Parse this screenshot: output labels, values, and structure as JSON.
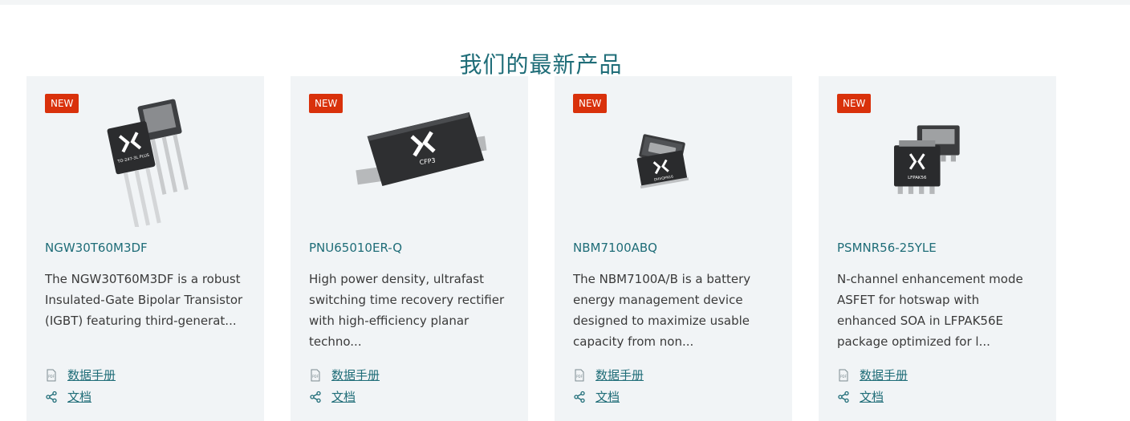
{
  "section": {
    "title": "我们的最新产品"
  },
  "colors": {
    "accent": "#1f6d78",
    "badge": "#d9310b",
    "card_bg": "#f1f4f6"
  },
  "products": [
    {
      "badge": "NEW",
      "name": "NGW30T60M3DF",
      "description": "The NGW30T60M3DF is a robust Insulated-Gate Bipolar Transistor (IGBT) featuring third-generat...",
      "package_label": "TO-247-3L PLUS",
      "datasheet_label": "数据手册",
      "docs_label": "文档"
    },
    {
      "badge": "NEW",
      "name": "PNU65010ER-Q",
      "description": "High power density, ultrafast switching time recovery rectifier with high-efficiency planar techno...",
      "package_label": "CFP3",
      "datasheet_label": "数据手册",
      "docs_label": "文档"
    },
    {
      "badge": "NEW",
      "name": "NBM7100ABQ",
      "description": "The NBM7100A/B is a battery energy management device designed to maximize usable capacity from non...",
      "package_label": "DHVQFN16",
      "datasheet_label": "数据手册",
      "docs_label": "文档"
    },
    {
      "badge": "NEW",
      "name": "PSMNR56-25YLE",
      "description": "N-channel enhancement mode ASFET for hotswap with enhanced SOA in LFPAK56E package optimized for l...",
      "package_label": "LFPAK56",
      "datasheet_label": "数据手册",
      "docs_label": "文档"
    }
  ]
}
